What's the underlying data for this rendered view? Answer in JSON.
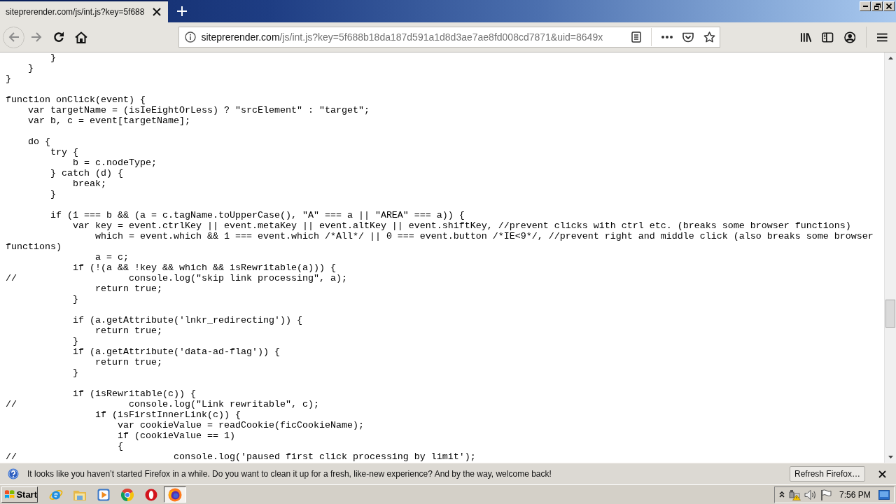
{
  "tabs": [
    {
      "title": "siteprerender.com/js/int.js?key=5f688",
      "selected": true
    }
  ],
  "navigation": [
    {
      "kind": "back",
      "disabled": true
    },
    {
      "kind": "forward",
      "disabled": true
    },
    {
      "kind": "reload",
      "disabled": false
    },
    {
      "kind": "home",
      "disabled": false
    }
  ],
  "address_bar": {
    "domain": "siteprerender.com",
    "path": "/js/int.js?key=5f688b18da187d591a1d8d3ae7ae8fd008cd7871&uid=8649x"
  },
  "page": {
    "code_blocks": [
      [
        "        }",
        "    }",
        "}"
      ],
      [
        "function onClick(event) {",
        "    var targetName = (isIeEightOrLess) ? \"srcElement\" : \"target\";",
        "    var b, c = event[targetName];"
      ],
      [
        "    do {",
        "        try {",
        "            b = c.nodeType;",
        "        } catch (d) {",
        "            break;",
        "        }"
      ],
      [
        "        if (1 === b && (a = c.tagName.toUpperCase(), \"A\" === a || \"AREA\" === a)) {",
        "            var key = event.ctrlKey || event.metaKey || event.altKey || event.shiftKey, //prevent clicks with ctrl etc. (breaks some browser functions)",
        "                which = event.which && 1 === event.which /*All*/ || 0 === event.button /*IE<9*/, //prevent right and middle click (also breaks some browser",
        "functions)",
        "                a = c;",
        "            if (!(a && !key && which && isRewritable(a))) {",
        "//                    console.log(\"skip link processing\", a);",
        "                return true;",
        "            }"
      ],
      [
        "            if (a.getAttribute('lnkr_redirecting')) {",
        "                return true;",
        "            }",
        "            if (a.getAttribute('data-ad-flag')) {",
        "                return true;",
        "            }"
      ],
      [
        "            if (isRewritable(c)) {",
        "//                    console.log(\"Link rewritable\", c);",
        "                if (isFirstInnerLink(c)) {",
        "                    var cookieValue = readCookie(ficCookieName);",
        "                    if (cookieValue == 1)",
        "                    {",
        "//                            console.log('paused first click processing by limit');"
      ]
    ]
  },
  "notification": {
    "message": "It looks like you haven’t started Firefox in a while. Do you want to clean it up for a fresh, like-new experience? And by the way, welcome back!",
    "button": "Refresh Firefox…"
  },
  "taskbar": {
    "start": "Start",
    "apps": [
      {
        "kind": "ie",
        "selected": false
      },
      {
        "kind": "explorer",
        "selected": false
      },
      {
        "kind": "media",
        "selected": false
      },
      {
        "kind": "chrome",
        "selected": false
      },
      {
        "kind": "opera",
        "selected": false
      },
      {
        "kind": "firefox",
        "selected": true
      }
    ],
    "clock": "7:56 PM"
  }
}
